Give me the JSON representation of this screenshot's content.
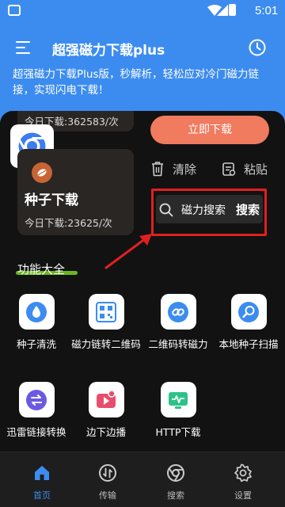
{
  "status_bar": {
    "time": "5:01"
  },
  "app_bar": {
    "title": "超强磁力下载plus"
  },
  "description": "超强磁力下载Plus版，秒解析，轻松应对冷门磁力链接，实现闪电下载！",
  "top_card": {
    "stat": "今日下载:362583/次"
  },
  "download_button": "立即下载",
  "seed_card": {
    "title": "种子下载",
    "stat": "今日下载:23625/次"
  },
  "actions": {
    "clear": "清除",
    "paste": "粘贴"
  },
  "search": {
    "label": "磁力搜索",
    "button": "搜索"
  },
  "features": {
    "title": "功能大全",
    "items": [
      {
        "label": "种子清洗",
        "icon": "drop-icon",
        "color": "#3c8cf0"
      },
      {
        "label": "磁力链转二维码",
        "icon": "qr-code-icon",
        "color": "#3c8cf0"
      },
      {
        "label": "二维码转磁力",
        "icon": "link-icon",
        "color": "#3c8cf0"
      },
      {
        "label": "本地种子扫描",
        "icon": "magnifier-icon",
        "color": "#3c8cf0"
      },
      {
        "label": "迅雷链接转换",
        "icon": "convert-icon",
        "color": "#6a5ae0"
      },
      {
        "label": "边下边播",
        "icon": "video-icon",
        "color": "#e84d6b"
      },
      {
        "label": "HTTP下载",
        "icon": "monitor-icon",
        "color": "#2ec28a"
      }
    ]
  },
  "nav": {
    "items": [
      {
        "label": "首页",
        "icon": "home-icon",
        "active": true
      },
      {
        "label": "传输",
        "icon": "transfer-icon",
        "active": false
      },
      {
        "label": "搜索",
        "icon": "chrome-icon",
        "active": false
      },
      {
        "label": "设置",
        "icon": "gear-icon",
        "active": false
      }
    ]
  },
  "colors": {
    "accent": "#3c8cf0",
    "download_button": "#f07b5f",
    "highlight": "#e02020",
    "underline": "#7bd322"
  }
}
